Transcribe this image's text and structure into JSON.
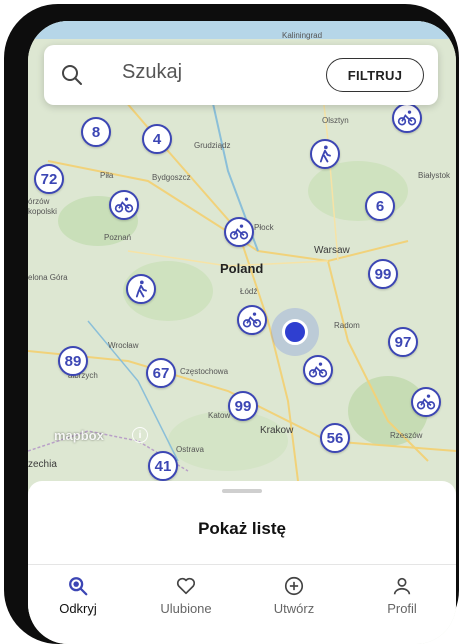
{
  "search": {
    "placeholder": "Szukaj",
    "filter_label": "FILTRUJ"
  },
  "map": {
    "labels": {
      "kaliningrad": "Kaliningrad",
      "olsztyn": "Olsztyn",
      "grudziadz": "Grudziądz",
      "bialystok": "Białystok",
      "pila": "Piła",
      "bydgoszcz": "Bydgoszcz",
      "gorzow": "órzów",
      "opolski": "kopolski",
      "poznan": "Poznań",
      "plock": "Płock",
      "warsaw": "Warsaw",
      "poland": "Poland",
      "zielona_gora": "elona Góra",
      "lodz": "Łódź",
      "radom": "Radom",
      "wroclaw": "Wrocław",
      "walbrzych": "ałbrzych",
      "czestochowa": "Częstochowa",
      "katowice": "Katow",
      "krakow": "Krakow",
      "rzeszow": "Rzeszów",
      "ostrava": "Ostrava",
      "czechia": "zechia"
    },
    "clusters": {
      "c8": "8",
      "c4": "4",
      "c72": "72",
      "c6": "6",
      "c99a": "99",
      "c97": "97",
      "c89": "89",
      "c67": "67",
      "c99b": "99",
      "c56": "56",
      "c41": "41"
    },
    "attribution": "mapbox"
  },
  "sheet": {
    "title": "Pokaż listę"
  },
  "tabs": {
    "discover": "Odkryj",
    "favorites": "Ulubione",
    "create": "Utwórz",
    "profile": "Profil"
  },
  "colors": {
    "accent": "#3c46b4",
    "location": "#2f3fd0"
  }
}
